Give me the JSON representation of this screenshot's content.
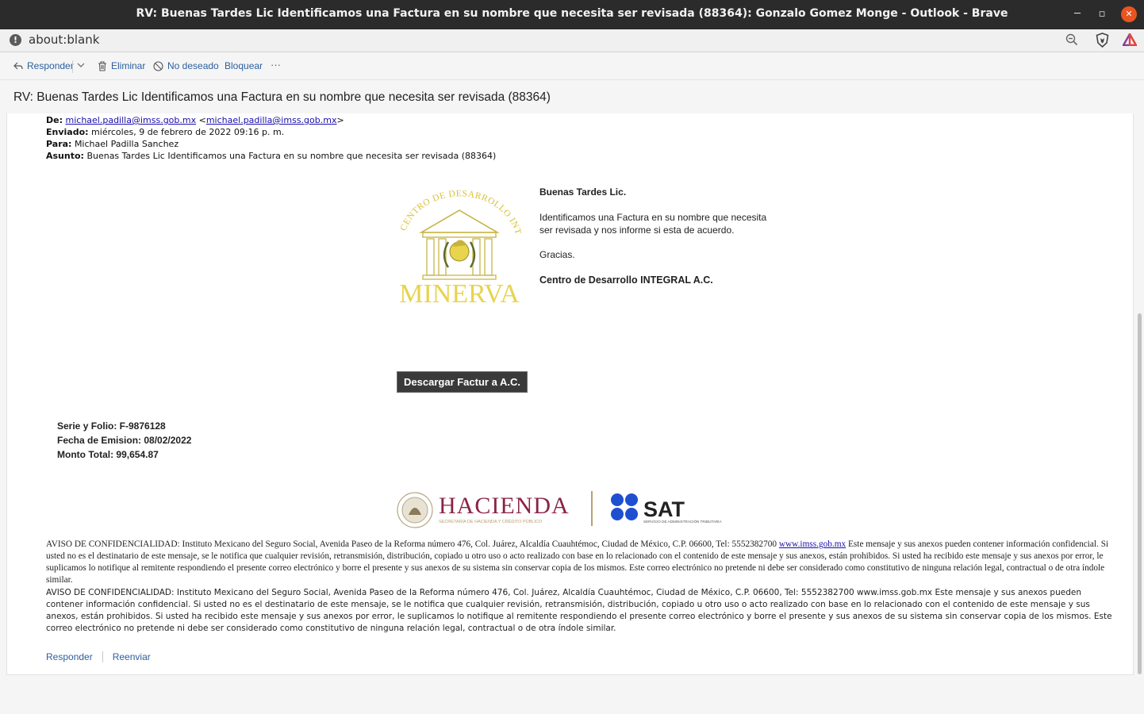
{
  "window": {
    "title": "RV: Buenas Tardes Lic Identificamos una Factura en su nombre que necesita ser revisada (88364): Gonzalo Gomez Monge - Outlook - Brave",
    "minimize": "─",
    "maximize": "▫",
    "close": "✕"
  },
  "address": {
    "url": "about:blank",
    "info": "!"
  },
  "toolbar": {
    "reply": "Responder",
    "delete": "Eliminar",
    "junk": "No deseado",
    "block": "Bloquear",
    "more": "···"
  },
  "subject": "RV: Buenas Tardes Lic Identificamos una Factura en su nombre que necesita ser revisada (88364)",
  "forward_header": {
    "from_label": "De:",
    "from_email": "michael.padilla@imss.gob.mx",
    "from_email2": "michael.padilla@imss.gob.mx",
    "sent_label": "Enviado:",
    "sent": "miércoles, 9 de febrero de 2022 09:16 p. m.",
    "to_label": "Para:",
    "to": "Michael Padilla Sanchez",
    "subject_label": "Asunto:",
    "subject": "Buenas Tardes Lic Identificamos una Factura en su nombre que necesita ser revisada (88364)"
  },
  "logo": {
    "arc_text": "CENTRO DE DESARROLLO INTEGRAL",
    "name": "MINERVA",
    "color": "#e8d44d"
  },
  "message": {
    "greeting": "Buenas Tardes Lic.",
    "line1": "Identificamos una Factura en su nombre que necesita",
    "line2": "ser revisada y nos informe si esta de acuerdo.",
    "thanks": "Gracias.",
    "signature": "Centro de Desarrollo INTEGRAL A.C."
  },
  "cta": {
    "label": "Descargar Factur a A.C."
  },
  "invoice": {
    "serie": "Serie y Folio: F-9876128",
    "fecha": "Fecha de Emision: 08/02/2022",
    "monto": "Monto Total: 99,654.87"
  },
  "banner": {
    "hacienda": "HACIENDA",
    "hacienda_sub": "SECRETARÍA DE HACIENDA Y CRÉDITO PÚBLICO",
    "sat": "SAT",
    "sat_sub": "SERVICIO DE ADMINISTRACIÓN TRIBUTARIA",
    "hacienda_color": "#8b2346",
    "sat_color": "#1f4fd1"
  },
  "legal": {
    "p1_a": "AVISO DE CONFIDENCIALIDAD: Instituto Mexicano del Seguro Social, Avenida Paseo de la Reforma número 476, Col. Juárez, Alcaldía Cuauhtémoc, Ciudad de México, C.P. 06600, Tel: 5552382700 ",
    "p1_link": "www.imss.gob.mx",
    "p1_b": " Este mensaje y sus anexos pueden contener información confidencial. Si usted no es el destinatario de este mensaje, se le notifica que cualquier revisión, retransmisión, distribución, copiado u otro uso o acto realizado con base en lo relacionado con el contenido de este mensaje y sus anexos, están prohibidos. Si usted ha recibido este mensaje y sus anexos por error, le suplicamos lo notifique al remitente respondiendo el presente correo electrónico y borre el presente y sus anexos de su sistema sin conservar copia de los mismos. Este correo electrónico no pretende ni debe ser considerado como constitutivo de ninguna relación legal, contractual o de otra índole similar.",
    "p2": "AVISO DE CONFIDENCIALIDAD: Instituto Mexicano del Seguro Social, Avenida Paseo de la Reforma número 476, Col. Juárez, Alcaldía Cuauhtémoc, Ciudad de México, C.P. 06600, Tel: 5552382700 www.imss.gob.mx Este mensaje y sus anexos pueden contener información confidencial. Si usted no es el destinatario de este mensaje, se le notifica que cualquier revisión, retransmisión, distribución, copiado u otro uso o acto realizado con base en lo relacionado con el contenido de este mensaje y sus anexos, están prohibidos. Si usted ha recibido este mensaje y sus anexos por error, le suplicamos lo notifique al remitente respondiendo el presente correo electrónico y borre el presente y sus anexos de su sistema sin conservar copia de los mismos. Este correo electrónico no pretende ni debe ser considerado como constitutivo de ninguna relación legal, contractual o de otra índole similar."
  },
  "footer": {
    "reply": "Responder",
    "forward": "Reenviar"
  }
}
